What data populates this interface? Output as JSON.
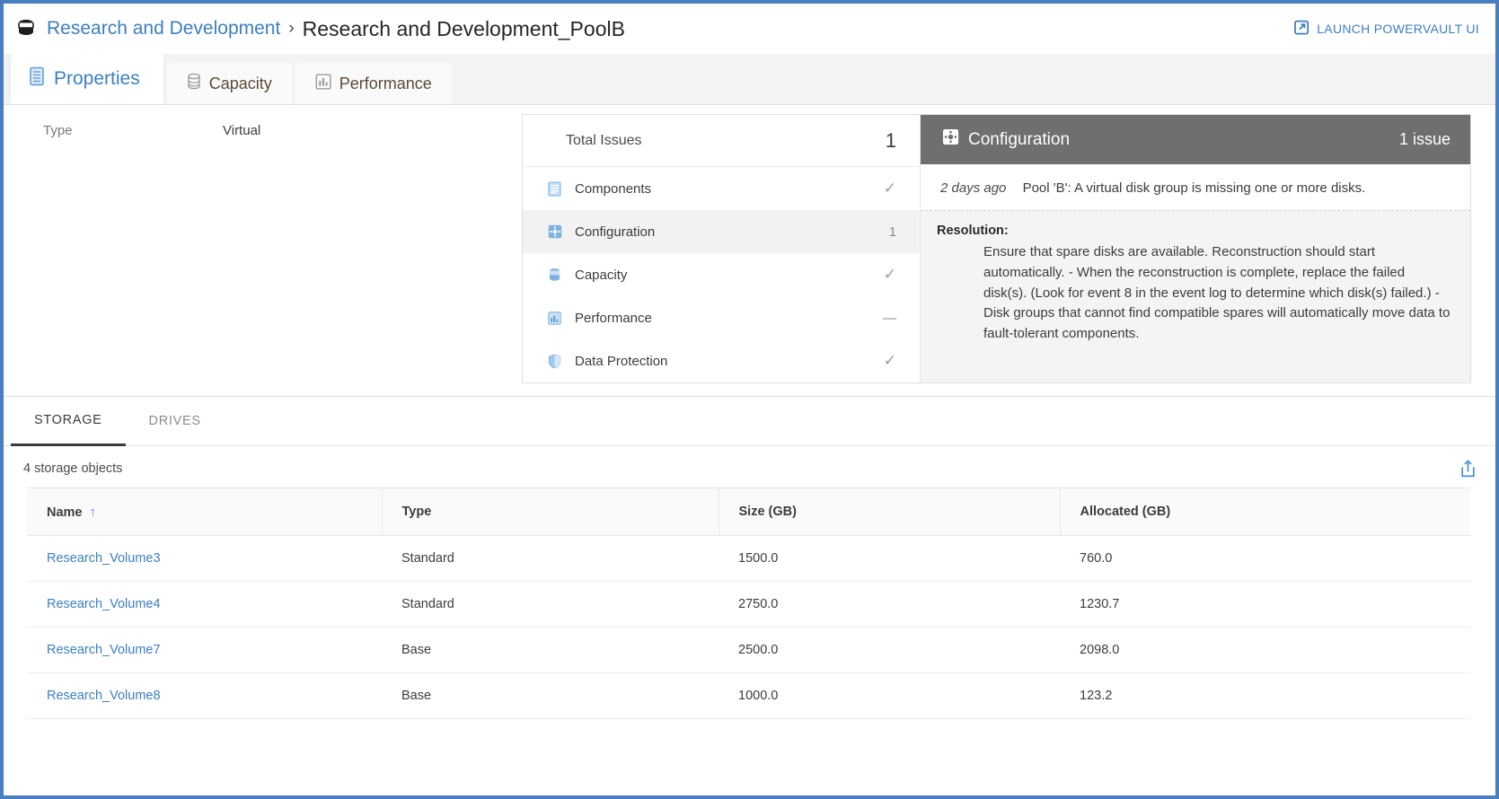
{
  "header": {
    "pool_icon": "database-icon",
    "breadcrumb_parent": "Research and Development",
    "breadcrumb_separator": "›",
    "breadcrumb_current": "Research and Development_PoolB",
    "launch_label": "LAUNCH POWERVAULT UI",
    "launch_icon": "external-link-icon",
    "accent_blue": "#3d7fc1"
  },
  "tabs": [
    {
      "label": "Properties",
      "icon": "properties-list-icon",
      "active": true
    },
    {
      "label": "Capacity",
      "icon": "database-icon",
      "active": false
    },
    {
      "label": "Performance",
      "icon": "bar-chart-icon",
      "active": false
    }
  ],
  "properties": {
    "type_label": "Type",
    "type_value": "Virtual"
  },
  "issues": {
    "total_label": "Total Issues",
    "total_count": "1",
    "categories": [
      {
        "label": "Components",
        "icon": "components-icon",
        "status": "✓",
        "selected": false,
        "is_check": true
      },
      {
        "label": "Configuration",
        "icon": "configuration-icon",
        "status": "1",
        "selected": true,
        "is_check": false
      },
      {
        "label": "Capacity",
        "icon": "capacity-icon",
        "status": "✓",
        "selected": false,
        "is_check": true
      },
      {
        "label": "Performance",
        "icon": "performance-icon",
        "status": "—",
        "selected": false,
        "is_check": false
      },
      {
        "label": "Data Protection",
        "icon": "data-protection-icon",
        "status": "✓",
        "selected": false,
        "is_check": true
      }
    ],
    "detail": {
      "title": "Configuration",
      "title_icon": "configuration-icon",
      "count_label": "1 issue",
      "header_bg": "#6f6f6f",
      "timestamp": "2 days ago",
      "message": "Pool 'B': A virtual disk group is missing one or more disks.",
      "resolution_label": "Resolution:",
      "resolution_text": "Ensure that spare disks are available. Reconstruction should start automatically. - When the reconstruction is complete, replace the failed disk(s). (Look for event 8 in the event log to determine which disk(s) failed.) - Disk groups that cannot find compatible spares will automatically move data to fault-tolerant components."
    }
  },
  "storage_section": {
    "tabs": [
      {
        "label": "STORAGE",
        "active": true
      },
      {
        "label": "DRIVES",
        "active": false
      }
    ],
    "count_text": "4 storage objects",
    "export_icon": "export-share-icon",
    "table": {
      "columns": [
        "Name",
        "Type",
        "Size (GB)",
        "Allocated (GB)"
      ],
      "sort_column": "Name",
      "sort_direction": "↑",
      "rows": [
        {
          "name": "Research_Volume3",
          "type": "Standard",
          "size": "1500.0",
          "allocated": "760.0"
        },
        {
          "name": "Research_Volume4",
          "type": "Standard",
          "size": "2750.0",
          "allocated": "1230.7"
        },
        {
          "name": "Research_Volume7",
          "type": "Base",
          "size": "2500.0",
          "allocated": "2098.0"
        },
        {
          "name": "Research_Volume8",
          "type": "Base",
          "size": "1000.0",
          "allocated": "123.2"
        }
      ]
    }
  }
}
